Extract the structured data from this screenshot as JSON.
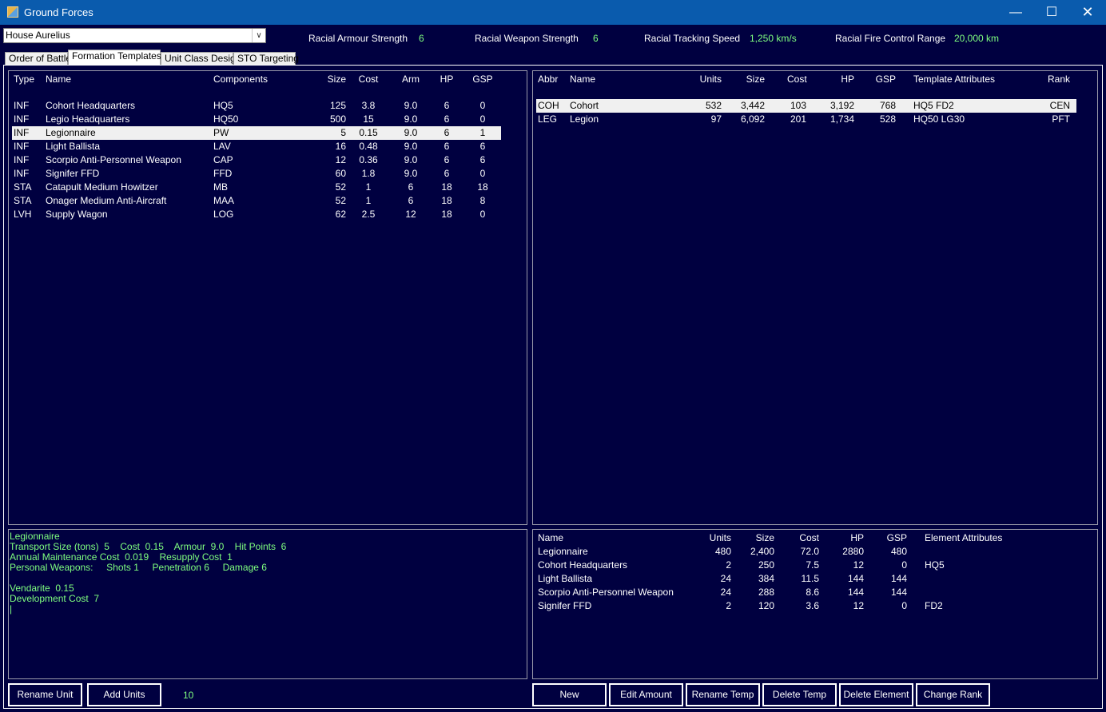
{
  "window": {
    "title": "Ground Forces",
    "minimize": "—",
    "maximize": "☐",
    "close": "✕"
  },
  "race_select": {
    "value": "House Aurelius"
  },
  "racial_stats": [
    {
      "label": "Racial Armour Strength",
      "value": "6"
    },
    {
      "label": "Racial Weapon Strength",
      "value": "6"
    },
    {
      "label": "Racial Tracking Speed",
      "value": "1,250 km/s"
    },
    {
      "label": "Racial Fire Control Range",
      "value": "20,000 km"
    }
  ],
  "tabs": [
    {
      "label": "Order of Battle"
    },
    {
      "label": "Formation Templates"
    },
    {
      "label": "Unit Class Design"
    },
    {
      "label": "STO Targeting"
    }
  ],
  "unit_class_table": {
    "columns": [
      "Type",
      "Name",
      "Components",
      "Size",
      "Cost",
      "Arm",
      "HP",
      "GSP"
    ],
    "rows": [
      [
        "INF",
        "Cohort Headquarters",
        "HQ5",
        "125",
        "3.8",
        "9.0",
        "6",
        "0"
      ],
      [
        "INF",
        "Legio Headquarters",
        "HQ50",
        "500",
        "15",
        "9.0",
        "6",
        "0"
      ],
      [
        "INF",
        "Legionnaire",
        "PW",
        "5",
        "0.15",
        "9.0",
        "6",
        "1"
      ],
      [
        "INF",
        "Light Ballista",
        "LAV",
        "16",
        "0.48",
        "9.0",
        "6",
        "6"
      ],
      [
        "INF",
        "Scorpio Anti-Personnel Weapon",
        "CAP",
        "12",
        "0.36",
        "9.0",
        "6",
        "6"
      ],
      [
        "INF",
        "Signifer FFD",
        "FFD",
        "60",
        "1.8",
        "9.0",
        "6",
        "0"
      ],
      [
        "STA",
        "Catapult Medium Howitzer",
        "MB",
        "52",
        "1",
        "6",
        "18",
        "18"
      ],
      [
        "STA",
        "Onager Medium Anti-Aircraft",
        "MAA",
        "52",
        "1",
        "6",
        "18",
        "8"
      ],
      [
        "LVH",
        "Supply Wagon",
        "LOG",
        "62",
        "2.5",
        "12",
        "18",
        "0"
      ]
    ]
  },
  "template_table": {
    "columns": [
      "Abbr",
      "Name",
      "Units",
      "Size",
      "Cost",
      "HP",
      "GSP",
      "Template Attributes",
      "Rank"
    ],
    "rows": [
      [
        "COH",
        "Cohort",
        "532",
        "3,442",
        "103",
        "3,192",
        "768",
        "HQ5  FD2",
        "CEN"
      ],
      [
        "LEG",
        "Legion",
        "97",
        "6,092",
        "201",
        "1,734",
        "528",
        "HQ50  LG30",
        "PFT"
      ]
    ]
  },
  "unit_info": {
    "lines": [
      "Legionnaire",
      "Transport Size (tons)  5    Cost  0.15    Armour  9.0    Hit Points  6",
      "Annual Maintenance Cost  0.019    Resupply Cost  1",
      "Personal Weapons:     Shots 1     Penetration 6     Damage 6",
      "",
      "Vendarite  0.15",
      "Development Cost  7",
      "|"
    ]
  },
  "element_table": {
    "columns": [
      "Name",
      "Units",
      "Size",
      "Cost",
      "HP",
      "GSP",
      "Element Attributes"
    ],
    "rows": [
      [
        "Legionnaire",
        "480",
        "2,400",
        "72.0",
        "2880",
        "480",
        ""
      ],
      [
        "Cohort Headquarters",
        "2",
        "250",
        "7.5",
        "12",
        "0",
        "HQ5"
      ],
      [
        "Light Ballista",
        "24",
        "384",
        "11.5",
        "144",
        "144",
        ""
      ],
      [
        "Scorpio Anti-Personnel Weapon",
        "24",
        "288",
        "8.6",
        "144",
        "144",
        ""
      ],
      [
        "Signifer FFD",
        "2",
        "120",
        "3.6",
        "12",
        "0",
        "FD2"
      ]
    ]
  },
  "buttons": {
    "rename_unit": "Rename Unit",
    "add_units": "Add Units",
    "units_amount": "10",
    "new": "New",
    "edit_amount": "Edit Amount",
    "rename_temp": "Rename Temp",
    "delete_temp": "Delete Temp",
    "delete_element": "Delete Element",
    "change_rank": "Change Rank"
  }
}
